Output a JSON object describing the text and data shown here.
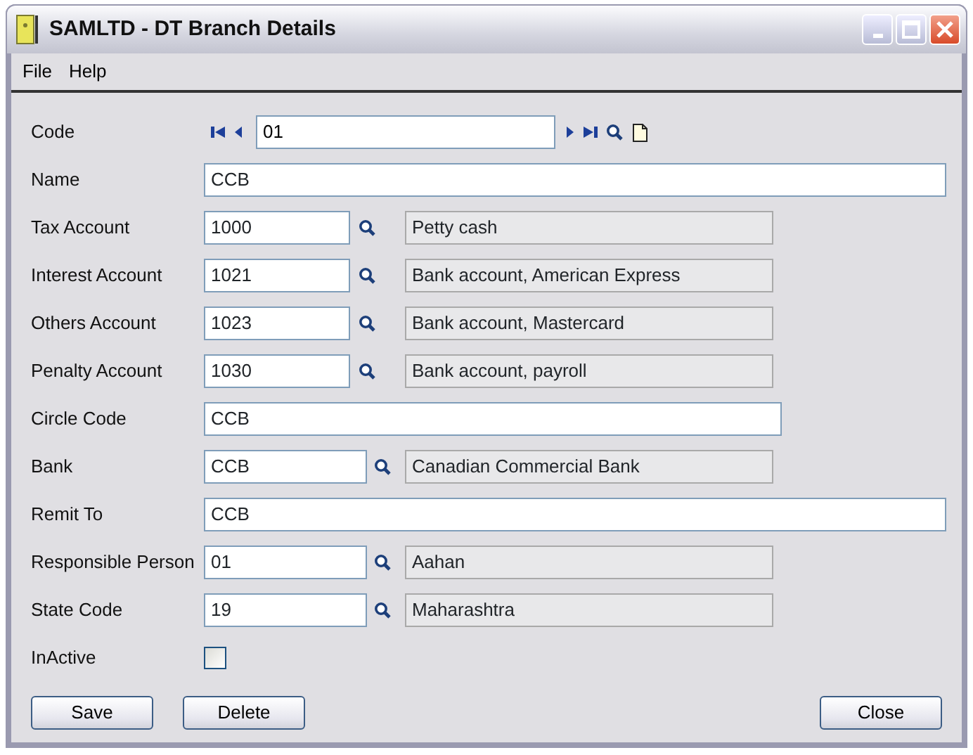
{
  "window": {
    "title": "SAMLTD - DT Branch Details"
  },
  "menu": [
    "File",
    "Help"
  ],
  "fields": [
    {
      "kind": "code",
      "label": "Code",
      "value": "01"
    },
    {
      "kind": "text",
      "label": "Name",
      "value": "CCB"
    },
    {
      "kind": "lookup",
      "label": "Tax Account",
      "value": "1000",
      "description": "Petty cash"
    },
    {
      "kind": "lookup",
      "label": "Interest Account",
      "value": "1021",
      "description": "Bank account, American Express"
    },
    {
      "kind": "lookup",
      "label": "Others Account",
      "value": "1023",
      "description": "Bank account, Mastercard"
    },
    {
      "kind": "lookup",
      "label": "Penalty Account",
      "value": "1030",
      "description": "Bank account, payroll"
    },
    {
      "kind": "text-short",
      "label": "Circle Code",
      "value": "CCB"
    },
    {
      "kind": "lookup-wide",
      "label": "Bank",
      "value": "CCB",
      "description": "Canadian Commercial Bank"
    },
    {
      "kind": "text",
      "label": "Remit To",
      "value": "CCB"
    },
    {
      "kind": "lookup-wide",
      "label": "Responsible Person",
      "value": "01",
      "description": "Aahan"
    },
    {
      "kind": "lookup-wide",
      "label": "State Code",
      "value": "19",
      "description": "Maharashtra"
    },
    {
      "kind": "checkbox",
      "label": "InActive",
      "checked": false
    }
  ],
  "buttons": [
    {
      "label": "Save",
      "kind": "action"
    },
    {
      "label": "Delete",
      "kind": "action"
    },
    {
      "label": "Close",
      "kind": "dismiss"
    }
  ]
}
